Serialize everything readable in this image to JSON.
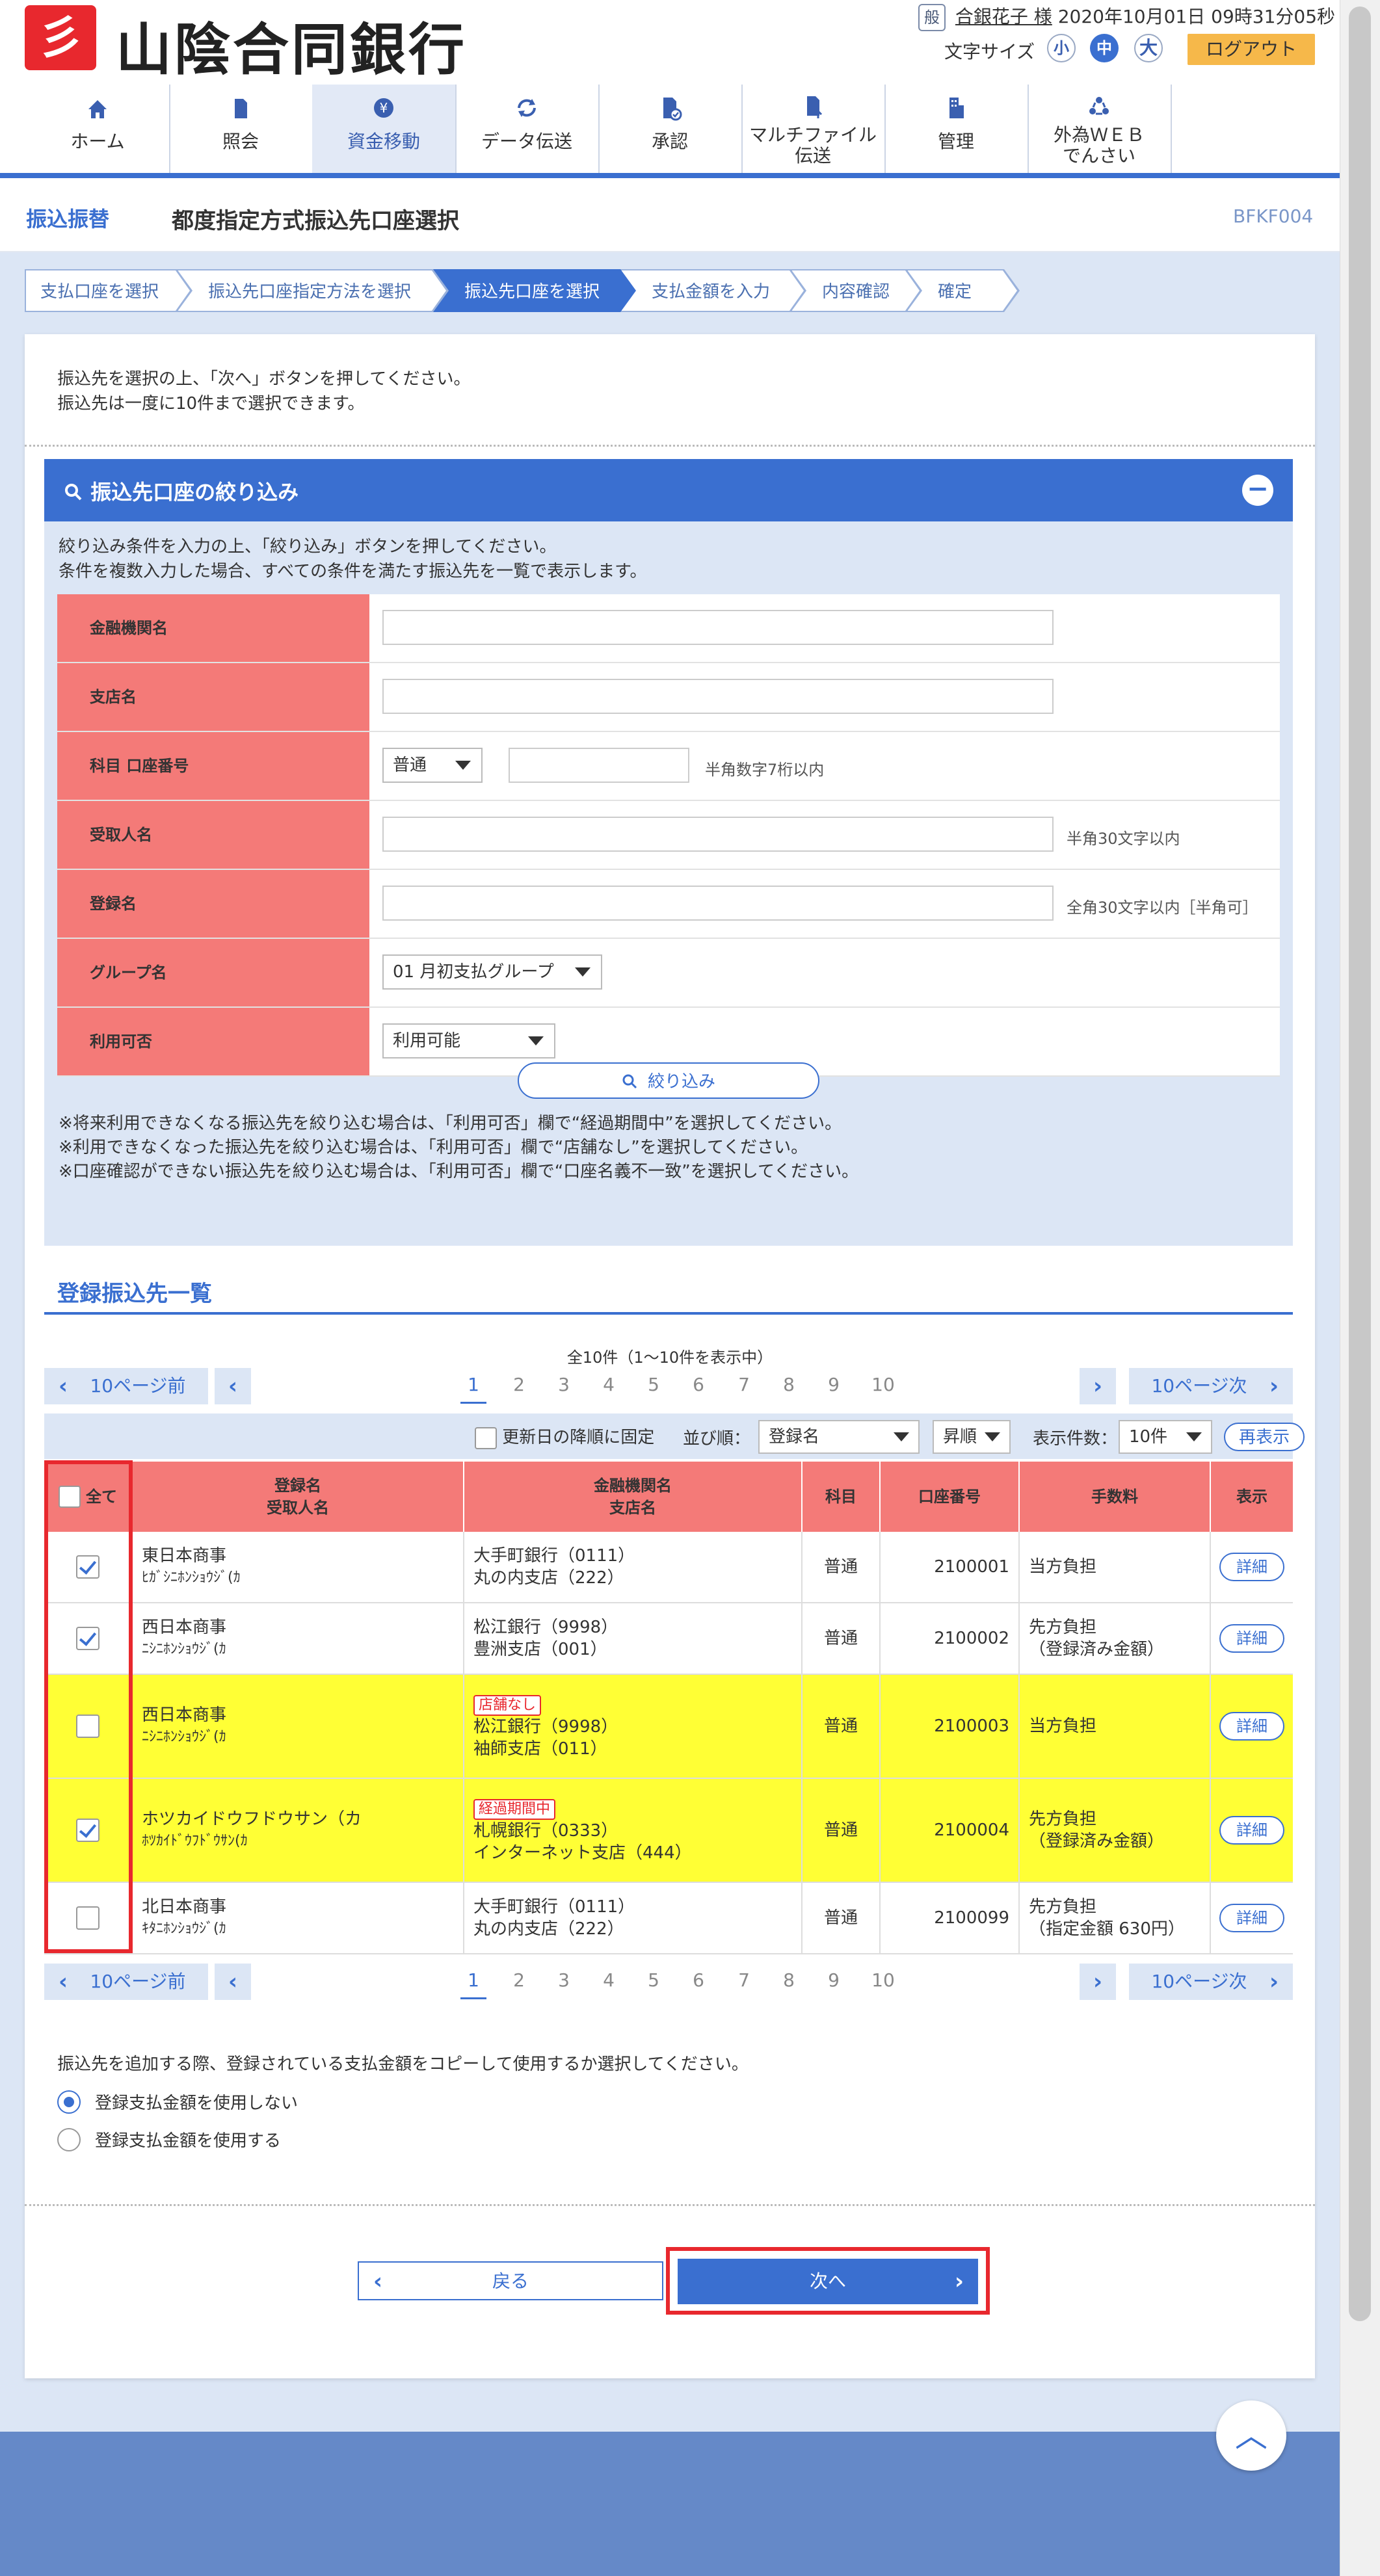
{
  "header": {
    "logo_mark": "彡",
    "bank_name": "山陰合同銀行",
    "user_badge": "般",
    "user_name": "合銀花子 様",
    "datetime": "2020年10月01日 09時31分05秒",
    "font_size_label": "文字サイズ",
    "font_small": "小",
    "font_mid": "中",
    "font_big": "大",
    "logout": "ログアウト"
  },
  "nav": [
    {
      "label": "ホーム",
      "icon": "home-icon"
    },
    {
      "label": "照会",
      "icon": "document-icon"
    },
    {
      "label": "資金移動",
      "icon": "yen-transfer-icon"
    },
    {
      "label": "データ伝送",
      "icon": "refresh-icon"
    },
    {
      "label": "承認",
      "icon": "approve-icon"
    },
    {
      "label": "マルチファイル",
      "label2": "伝送",
      "icon": "file-upload-icon"
    },
    {
      "label": "管理",
      "icon": "building-icon"
    },
    {
      "label": "外為ＷＥＢ",
      "label2": "でんさい",
      "icon": "recycle-icon"
    }
  ],
  "title": {
    "category": "振込振替",
    "main": "都度指定方式振込先口座選択",
    "code": "BFKF004"
  },
  "steps": [
    "支払口座を選択",
    "振込先口座指定方法を選択",
    "振込先口座を選択",
    "支払金額を入力",
    "内容確認",
    "確定"
  ],
  "intro": {
    "line1": "振込先を選択の上、「次へ」ボタンを押してください。",
    "line2": "振込先は一度に10件まで選択できます。"
  },
  "filter": {
    "title": "振込先口座の絞り込み",
    "desc1": "絞り込み条件を入力の上、「絞り込み」ボタンを押してください。",
    "desc2": "条件を複数入力した場合、すべての条件を満たす振込先を一覧で表示します。",
    "labels": {
      "bank": "金融機関名",
      "branch": "支店名",
      "account": "科目 口座番号",
      "recipient": "受取人名",
      "regname": "登録名",
      "group": "グループ名",
      "usable": "利用可否"
    },
    "account_type": "普通",
    "account_hint": "半角数字7桁以内",
    "recipient_hint": "半角30文字以内",
    "regname_hint": "全角30文字以内［半角可］",
    "group_value": "01 月初支払グループ",
    "usable_value": "利用可能",
    "button": "絞り込み",
    "note1": "※将来利用できなくなる振込先を絞り込む場合は、「利用可否」欄で“経過期間中”を選択してください。",
    "note2": "※利用できなくなった振込先を絞り込む場合は、「利用可否」欄で“店舗なし”を選択してください。",
    "note3": "※口座確認ができない振込先を絞り込む場合は、「利用可否」欄で“口座名義不一致”を選択してください。"
  },
  "list": {
    "title": "登録振込先一覧",
    "total": "全10件（1～10件を表示中）",
    "prev10": "10ページ前",
    "next10": "10ページ次",
    "pages": [
      "1",
      "2",
      "3",
      "4",
      "5",
      "6",
      "7",
      "8",
      "9",
      "10"
    ],
    "current_page": "1",
    "fix_label": "更新日の降順に固定",
    "sort_label": "並び順：",
    "sort_value": "登録名",
    "order_value": "昇順",
    "count_label": "表示件数：",
    "count_value": "10件",
    "redisplay": "再表示",
    "headers": {
      "all": "全て",
      "name1": "登録名",
      "name2": "受取人名",
      "bank1": "金融機関名",
      "bank2": "支店名",
      "type": "科目",
      "account": "口座番号",
      "fee": "手数料",
      "view": "表示"
    },
    "rows": [
      {
        "checked": true,
        "name": "東日本商事",
        "kana": "ﾋｶﾞｼﾆﾎﾝｼｮｳｼﾞ(ｶ",
        "tag": "",
        "bank": "大手町銀行（0111）",
        "branch": "丸の内支店（222）",
        "type": "普通",
        "account": "2100001",
        "fee1": "当方負担",
        "fee2": "",
        "detail": "詳細",
        "highlight": false
      },
      {
        "checked": true,
        "name": "西日本商事",
        "kana": "ﾆｼﾆﾎﾝｼｮｳｼﾞ(ｶ",
        "tag": "",
        "bank": "松江銀行（9998）",
        "branch": "豊洲支店（001）",
        "type": "普通",
        "account": "2100002",
        "fee1": "先方負担",
        "fee2": "（登録済み金額）",
        "detail": "詳細",
        "highlight": false
      },
      {
        "checked": false,
        "name": "西日本商事",
        "kana": "ﾆｼﾆﾎﾝｼｮｳｼﾞ(ｶ",
        "tag": "店舗なし",
        "bank": "松江銀行（9998）",
        "branch": "袖師支店（011）",
        "type": "普通",
        "account": "2100003",
        "fee1": "当方負担",
        "fee2": "",
        "detail": "詳細",
        "highlight": true
      },
      {
        "checked": true,
        "name": "ホツカイドウフドウサン（カ",
        "kana": "ﾎﾂｶｲﾄﾞｳﾌﾄﾞｳｻﾝ(ｶ",
        "tag": "経過期間中",
        "bank": "札幌銀行（0333）",
        "branch": "インターネット支店（444）",
        "type": "普通",
        "account": "2100004",
        "fee1": "先方負担",
        "fee2": "（登録済み金額）",
        "detail": "詳細",
        "highlight": true
      },
      {
        "checked": false,
        "name": "北日本商事",
        "kana": "ｷﾀﾆﾎﾝｼｮｳｼﾞ(ｶ",
        "tag": "",
        "bank": "大手町銀行（0111）",
        "branch": "丸の内支店（222）",
        "type": "普通",
        "account": "2100099",
        "fee1": "先方負担",
        "fee2": "（指定金額 630円）",
        "detail": "詳細",
        "highlight": false
      }
    ]
  },
  "copy": {
    "question": "振込先を追加する際、登録されている支払金額をコピーして使用するか選択してください。",
    "opt1": "登録支払金額を使用しない",
    "opt2": "登録支払金額を使用する",
    "selected": "opt1"
  },
  "buttons": {
    "back": "戻る",
    "next": "次へ"
  },
  "colors": {
    "primary": "#3a6fd0",
    "label_bg": "#f47a78",
    "highlight_row": "#ffff35",
    "annotation_red": "#e8282e",
    "logout_bg": "#f6b84a",
    "footer": "#6589c8"
  }
}
